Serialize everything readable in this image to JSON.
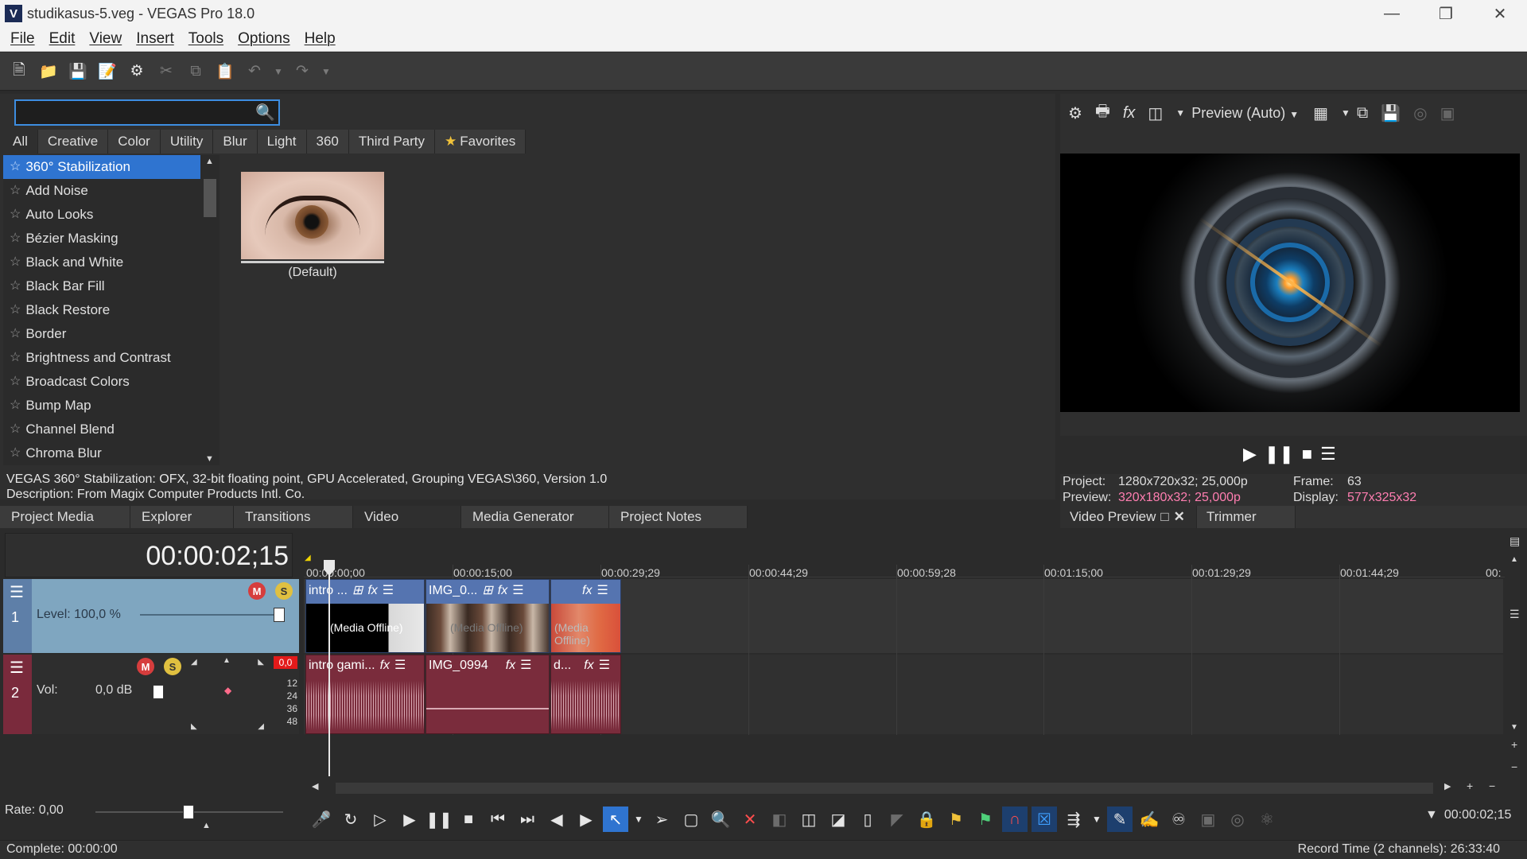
{
  "window": {
    "title": "studikasus-5.veg - VEGAS Pro 18.0",
    "app_icon": "V"
  },
  "menu": [
    "File",
    "Edit",
    "View",
    "Insert",
    "Tools",
    "Options",
    "Help"
  ],
  "fx_panel": {
    "search_value": "",
    "filter_tabs": [
      "All",
      "Creative",
      "Color",
      "Utility",
      "Blur",
      "Light",
      "360",
      "Third Party",
      "Favorites"
    ],
    "items": [
      "360° Stabilization",
      "Add Noise",
      "Auto Looks",
      "Bézier Masking",
      "Black and White",
      "Black Bar Fill",
      "Black Restore",
      "Border",
      "Brightness and Contrast",
      "Broadcast Colors",
      "Bump Map",
      "Channel Blend",
      "Chroma Blur"
    ],
    "selected_index": 0,
    "preset_label": "(Default)",
    "description_line1": "VEGAS 360° Stabilization: OFX, 32-bit floating point, GPU Accelerated, Grouping VEGAS\\360, Version 1.0",
    "description_line2": "Description: From Magix Computer Products Intl. Co."
  },
  "dock_tabs_left": [
    "Project Media",
    "Explorer",
    "Transitions",
    "Video FX",
    "Media Generator",
    "Project Notes"
  ],
  "dock_tabs_right": [
    "Video Preview",
    "Trimmer"
  ],
  "preview": {
    "mode_label": "Preview (Auto)",
    "project_label": "Project:",
    "project_value": "1280x720x32; 25,000p",
    "preview_label": "Preview:",
    "preview_value": "320x180x32; 25,000p",
    "frame_label": "Frame:",
    "frame_value": "63",
    "display_label": "Display:",
    "display_value": "577x325x32"
  },
  "timeline": {
    "timecode": "00:00:02;15",
    "ruler_ticks": [
      "00:00:00;00",
      "00:00:15;00",
      "00:00:29;29",
      "00:00:44;29",
      "00:00:59;28",
      "00:01:15;00",
      "00:01:29;29",
      "00:01:44;29",
      "00:"
    ],
    "video_track": {
      "number": "1",
      "level_label": "Level: 100,0 %"
    },
    "audio_track": {
      "number": "2",
      "vol_label": "Vol:",
      "vol_value": "0,0 dB",
      "peak": "0,0",
      "meter_marks": [
        "12",
        "24",
        "36",
        "48"
      ]
    },
    "video_clips": [
      {
        "name": "intro ...",
        "offline": "(Media Offline)"
      },
      {
        "name": "IMG_0...",
        "offline": "(Media Offline)"
      },
      {
        "name": "",
        "offline": "(Media Offline)"
      }
    ],
    "audio_clips": [
      {
        "name": "intro gami..."
      },
      {
        "name": "IMG_0994"
      },
      {
        "name": "d..."
      }
    ],
    "rate_label": "Rate: 0,00",
    "end_timecode": "00:00:02;15"
  },
  "status": {
    "left": "Complete: 00:00:00",
    "right": "Record Time (2 channels): 26:33:40"
  },
  "colors": {
    "accent": "#2f74d0",
    "video_track": "#7fa6c0",
    "audio_track": "#7a2a3c",
    "pink_value": "#ff7eb1"
  }
}
